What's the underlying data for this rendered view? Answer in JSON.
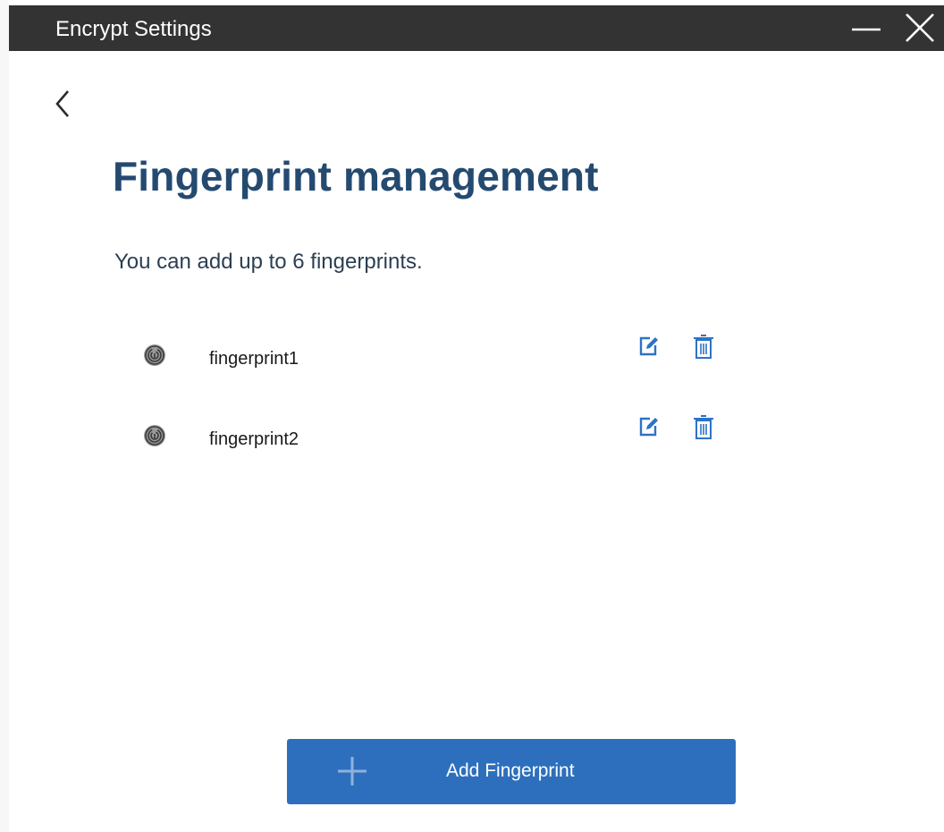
{
  "window": {
    "title": "Encrypt Settings",
    "titlebar_color": "#333333",
    "controls": [
      {
        "name": "minimize",
        "icon": "minimize-icon"
      },
      {
        "name": "close",
        "icon": "close-icon"
      }
    ]
  },
  "nav": {
    "back_icon": "chevron-left-icon"
  },
  "main": {
    "title": "Fingerprint management",
    "subtitle": "You can add up to 6 fingerprints.",
    "title_color": "#244a70",
    "fingerprints": [
      {
        "name": "fingerprint1",
        "icon": "fingerprint-icon",
        "actions": [
          "edit-icon",
          "trash-icon"
        ]
      },
      {
        "name": "fingerprint2",
        "icon": "fingerprint-icon",
        "actions": [
          "edit-icon",
          "trash-icon"
        ]
      }
    ],
    "action_color": "#2d73c4",
    "add_button": {
      "label": "Add Fingerprint",
      "icon": "plus-icon",
      "color": "#2d6fbc"
    }
  }
}
